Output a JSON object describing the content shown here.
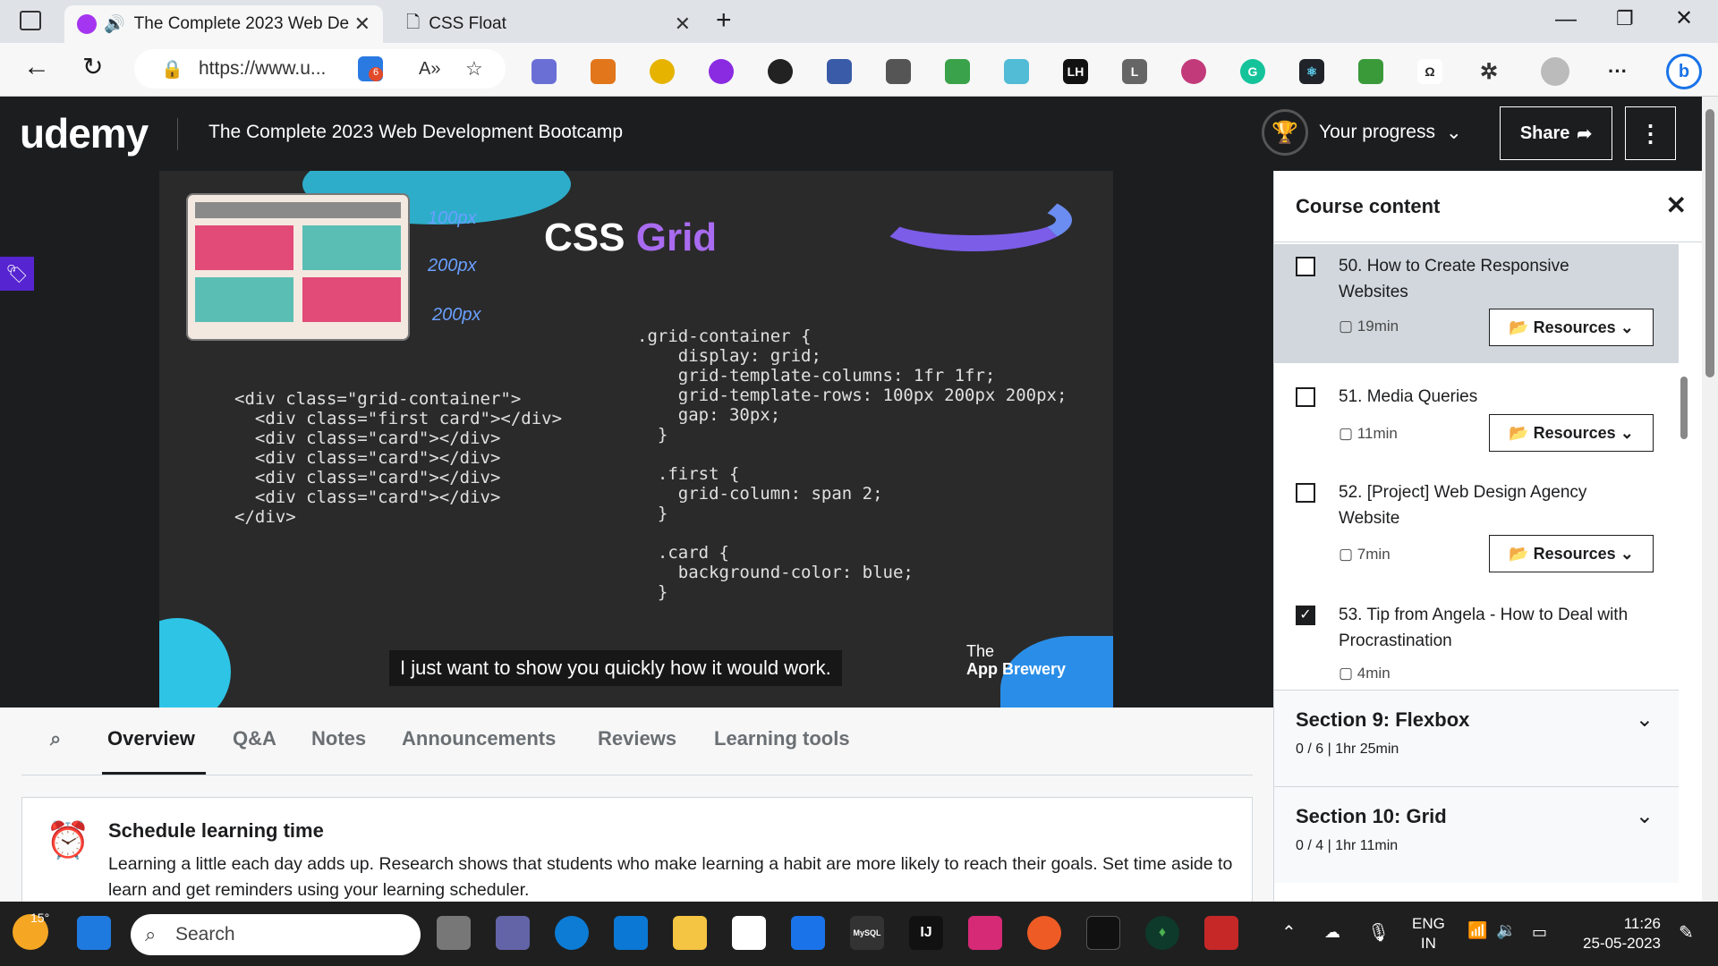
{
  "browser": {
    "tabs": [
      {
        "title": "The Complete 2023 Web De",
        "active": true
      },
      {
        "title": "CSS Float",
        "active": false
      }
    ],
    "url": "https://www.u...",
    "extension_badge": "6"
  },
  "header": {
    "logo": "udemy",
    "course_title": "The Complete 2023 Web Development Bootcamp",
    "progress_label": "Your progress",
    "share_label": "Share"
  },
  "video": {
    "slide_title_a": "CSS",
    "slide_title_b": "Grid",
    "caption": "I just want to show you quickly how it would work.",
    "brand_line1": "The",
    "brand_line2": "App Brewery",
    "html_code": [
      "<div class=\"grid-container\">",
      "  <div class=\"first card\"></div>",
      "  <div class=\"card\"></div>",
      "  <div class=\"card\"></div>",
      "  <div class=\"card\"></div>",
      "  <div class=\"card\"></div>",
      "</div>"
    ],
    "css_code": [
      ".grid-container {",
      "    display: grid;",
      "    grid-template-columns: 1fr 1fr;",
      "    grid-template-rows: 100px 200px 200px;",
      "    gap: 30px;",
      "  }",
      "",
      "  .first {",
      "    grid-column: span 2;",
      "  }",
      "",
      "  .card {",
      "    background-color: blue;",
      "  }"
    ],
    "annotations": [
      "100px",
      "200px",
      "200px"
    ]
  },
  "course_content": {
    "title": "Course content",
    "items": [
      {
        "title": "50. How to Create Responsive Websites",
        "duration": "19min",
        "resources": "Resources",
        "checked": false
      },
      {
        "title": "51. Media Queries",
        "duration": "11min",
        "resources": "Resources",
        "checked": false
      },
      {
        "title": "52. [Project] Web Design Agency Website",
        "duration": "7min",
        "resources": "Resources",
        "checked": false
      },
      {
        "title": "53. Tip from Angela - How to Deal with Procrastination",
        "duration": "4min",
        "checked": true
      }
    ],
    "sections": [
      {
        "title": "Section 9: Flexbox",
        "sub": "0 / 6 | 1hr 25min"
      },
      {
        "title": "Section 10: Grid",
        "sub": "0 / 4 | 1hr 11min"
      }
    ]
  },
  "tabs": [
    "Overview",
    "Q&A",
    "Notes",
    "Announcements",
    "Reviews",
    "Learning tools"
  ],
  "schedule": {
    "title": "Schedule learning time",
    "text": "Learning a little each day adds up. Research shows that students who make learning a habit are more likely to reach their goals. Set time aside to learn and get reminders using your learning scheduler."
  },
  "taskbar": {
    "weather": "15°",
    "search_placeholder": "Search",
    "lang": "ENG",
    "region": "IN",
    "time": "11:26",
    "date": "25-05-2023"
  }
}
